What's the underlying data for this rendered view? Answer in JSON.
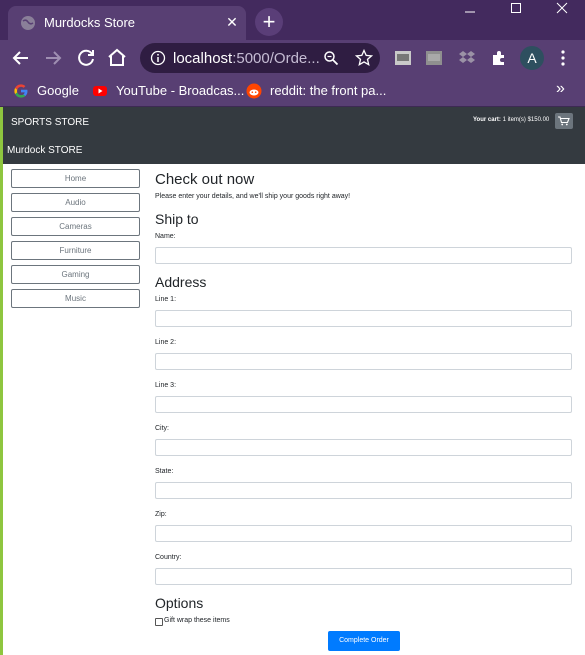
{
  "browser": {
    "tab_title": "Murdocks Store",
    "url_host": "localhost",
    "url_rest": ":5000/Orde...",
    "avatar_initial": "A",
    "bookmarks": [
      {
        "label": "Google",
        "icon": "google-icon"
      },
      {
        "label": "YouTube - Broadcas...",
        "icon": "youtube-icon"
      },
      {
        "label": "reddit: the front pa...",
        "icon": "reddit-icon"
      }
    ],
    "more_bookmarks": "»"
  },
  "header": {
    "brand": "SPORTS STORE",
    "subbrand": "Murdock STORE",
    "cart_label": "Your cart:",
    "cart_value": "1 item(s) $150.00"
  },
  "categories": [
    "Home",
    "Audio",
    "Cameras",
    "Furniture",
    "Gaming",
    "Music"
  ],
  "checkout": {
    "title": "Check out now",
    "intro": "Please enter your details, and we'll ship your goods right away!",
    "ship_heading": "Ship to",
    "name_label": "Name:",
    "address_heading": "Address",
    "fields": [
      "Line 1:",
      "Line 2:",
      "Line 3:",
      "City:",
      "State:",
      "Zip:",
      "Country:"
    ],
    "options_heading": "Options",
    "gift_label": "Gift wrap these items",
    "submit_label": "Complete Order"
  },
  "colors": {
    "chrome_titlebar": "#432a5e",
    "chrome_toolbar": "#583f73",
    "header_bg": "#343a40",
    "accent_green": "#8ec63f",
    "primary_button": "#007bff"
  }
}
